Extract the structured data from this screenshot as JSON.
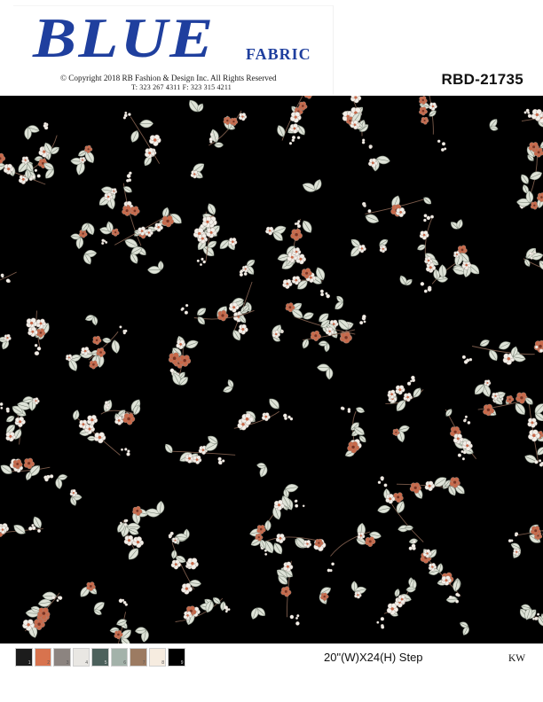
{
  "header": {
    "brand": "BLUE",
    "brand_subtitle": "FABRIC",
    "copyright": "© Copyright  2018  RB  Fashion & Design Inc. All Rights Reserved",
    "contact": "T: 323 267 4311   F: 323 315 4211",
    "design_code": "RBD-21735",
    "brand_color": "#1f3f9e"
  },
  "print": {
    "background_color": "#000000",
    "motif": "floral-sprig-icon",
    "leaf_color": "#dfe3d8",
    "petal_color": "#f3efe9",
    "accent_color": "#c8694a",
    "stem_color": "#7a5a4a"
  },
  "footer": {
    "swatches": [
      {
        "number": "1",
        "color": "#1c1c1c"
      },
      {
        "number": "2",
        "color": "#d8734e"
      },
      {
        "number": "3",
        "color": "#8c8480"
      },
      {
        "number": "4",
        "color": "#e9e7e3"
      },
      {
        "number": "5",
        "color": "#4c615c"
      },
      {
        "number": "6",
        "color": "#a3b2aa"
      },
      {
        "number": "7",
        "color": "#9c7b62"
      },
      {
        "number": "8",
        "color": "#f6ece0"
      },
      {
        "number": "9",
        "color": "#000000"
      }
    ],
    "repeat_size": "20\"(W)X24(H)  Step",
    "designer_initials": "KW"
  }
}
